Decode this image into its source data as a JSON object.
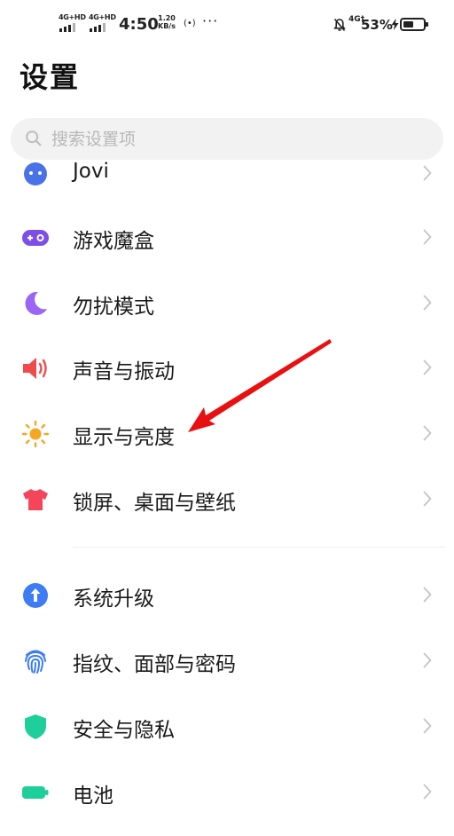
{
  "status_bar": {
    "sim1_network": "4G+HD",
    "sim2_network": "4G+HD",
    "time": "4:50",
    "net_speed_value": "1.20",
    "net_speed_unit": "KB/s",
    "hotspot_symbol": "(•)",
    "more_indicator": "···",
    "right_network": "4G†",
    "battery_percent": "53%",
    "battery_level": 0.53,
    "icons": [
      "signal-bars-icon",
      "hotspot-icon",
      "mute-bell-icon",
      "charging-bolt-icon",
      "battery-icon"
    ]
  },
  "page": {
    "title": "设置"
  },
  "search": {
    "placeholder": "搜索设置项",
    "value": ""
  },
  "settings": {
    "items": [
      {
        "label": "Jovi",
        "icon": "jovi-icon",
        "color": "#4a72e8"
      },
      {
        "label": "游戏魔盒",
        "icon": "game-box-icon",
        "color": "#7e4fe6"
      },
      {
        "label": "勿扰模式",
        "icon": "moon-icon",
        "color": "#9b65f5"
      },
      {
        "label": "声音与振动",
        "icon": "speaker-icon",
        "color": "#f04b4b"
      },
      {
        "label": "显示与亮度",
        "icon": "sun-icon",
        "color": "#f5a623"
      },
      {
        "label": "锁屏、桌面与壁纸",
        "icon": "tshirt-icon",
        "color": "#f5455a"
      },
      {
        "label": "系统升级",
        "icon": "upgrade-arrow-icon",
        "color": "#3d7cf5"
      },
      {
        "label": "指纹、面部与密码",
        "icon": "fingerprint-icon",
        "color": "#3d7cf5"
      },
      {
        "label": "安全与隐私",
        "icon": "shield-icon",
        "color": "#1fcf9b"
      },
      {
        "label": "电池",
        "icon": "battery-item-icon",
        "color": "#1fcf9b"
      }
    ]
  },
  "colors": {
    "annotation_arrow": "#e81010",
    "chevron": "#c4c4c4",
    "search_bg": "#f2f2f2"
  }
}
